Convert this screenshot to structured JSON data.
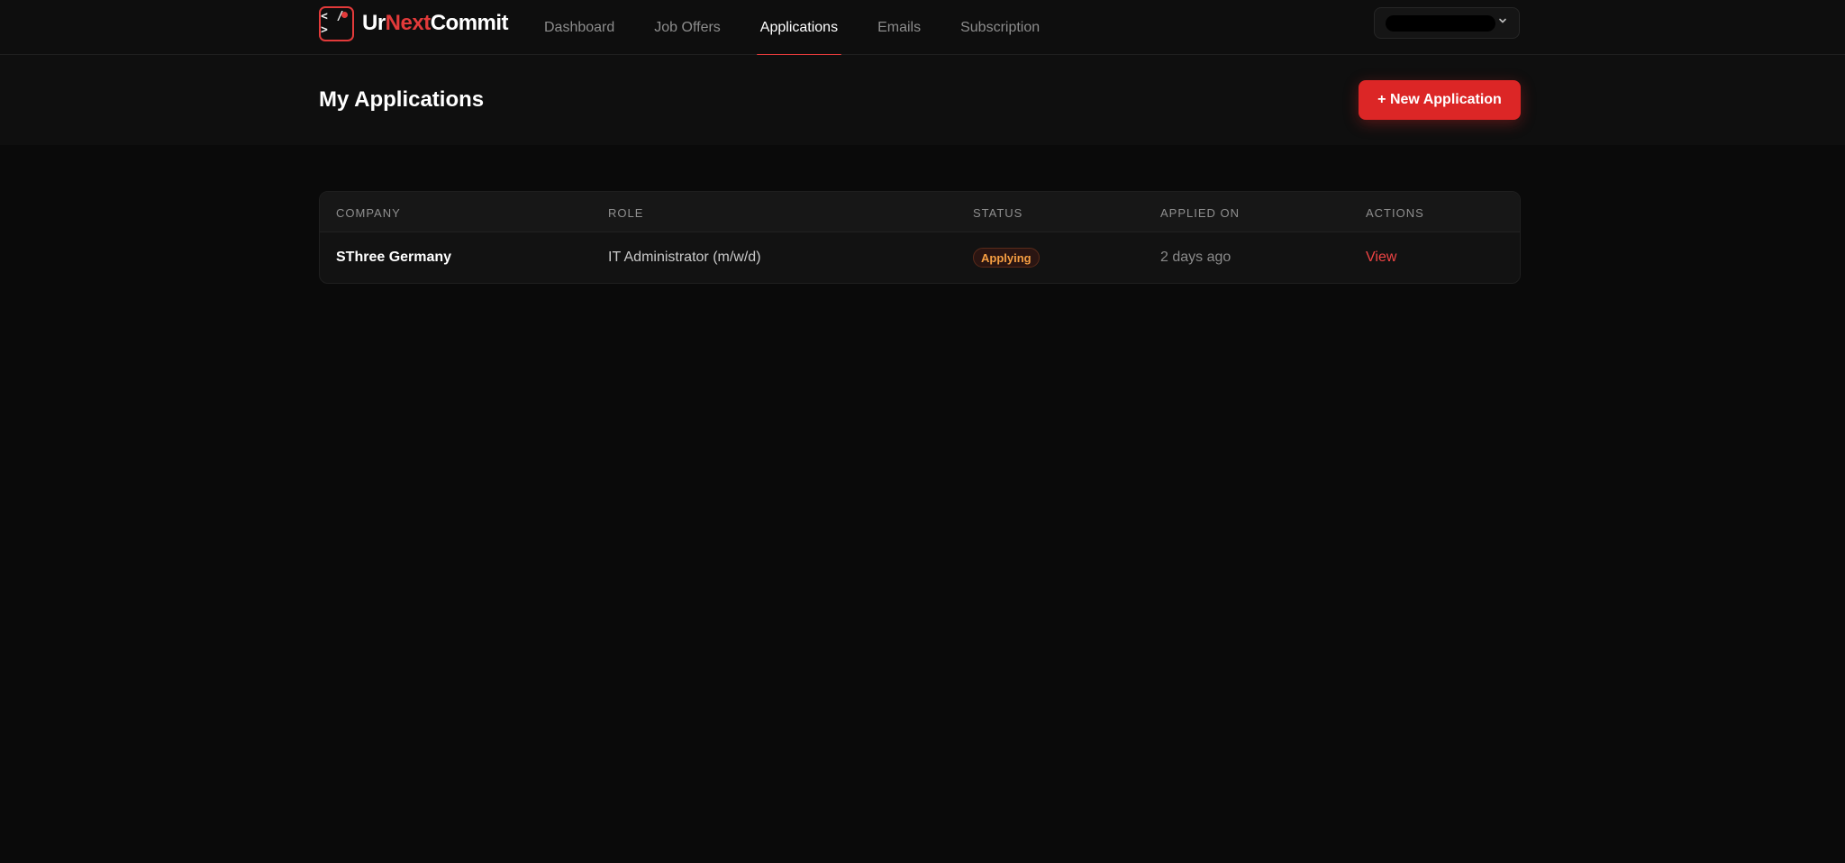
{
  "app": {
    "logo_code": "< / >",
    "brand_part1": "Ur",
    "brand_part2": "Next",
    "brand_part3": "Commit",
    "accent_color": "#e23a3a"
  },
  "nav": {
    "items": [
      {
        "label": "Dashboard",
        "active": false
      },
      {
        "label": "Job Offers",
        "active": false
      },
      {
        "label": "Applications",
        "active": true
      },
      {
        "label": "Emails",
        "active": false
      },
      {
        "label": "Subscription",
        "active": false
      }
    ]
  },
  "user_menu": {
    "icon": "chevron-down-icon"
  },
  "page": {
    "title": "My Applications",
    "new_button_label": "+ New Application"
  },
  "table": {
    "columns": [
      "COMPANY",
      "ROLE",
      "STATUS",
      "APPLIED ON",
      "ACTIONS"
    ],
    "rows": [
      {
        "company": "SThree Germany",
        "role": "IT Administrator (m/w/d)",
        "status": "Applying",
        "applied_on": "2 days ago",
        "action": "View"
      }
    ]
  }
}
